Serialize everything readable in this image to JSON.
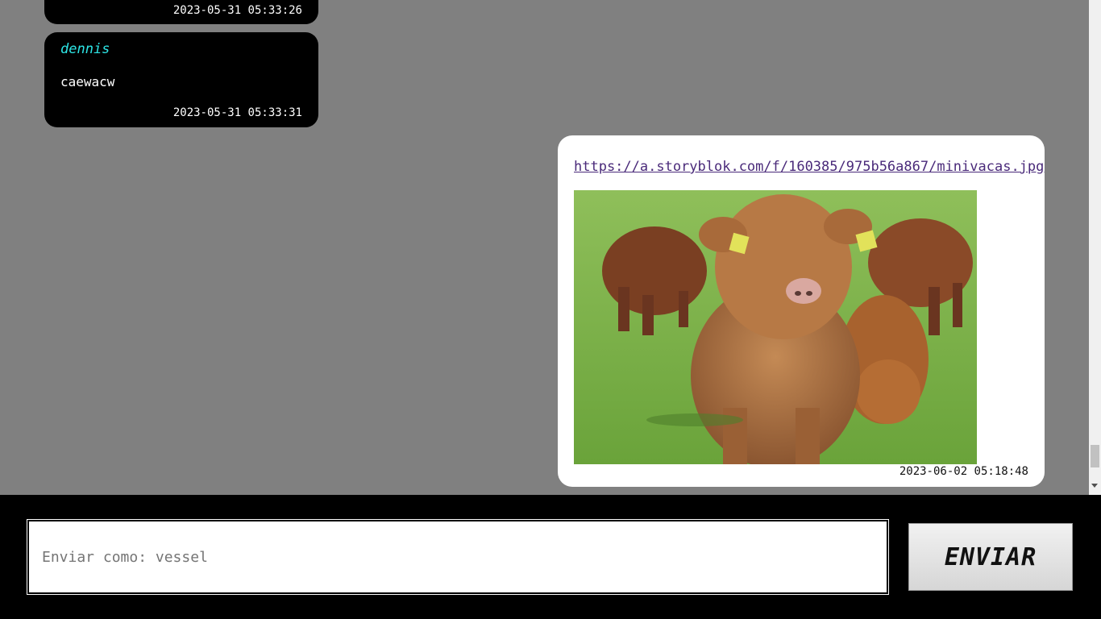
{
  "messages": [
    {
      "timestamp": "2023-05-31 05:33:26"
    },
    {
      "user": "dennis",
      "text": "caewacw",
      "timestamp": "2023-05-31 05:33:31"
    },
    {
      "link": "https://a.storyblok.com/f/160385/975b56a867/minivacas.jpg",
      "image": "photo of fluffy highland calves on grass",
      "timestamp": "2023-06-02 05:18:48"
    }
  ],
  "composer": {
    "placeholder": "Enviar como: vessel",
    "send_label": "ENVIAR"
  },
  "colors": {
    "background": "#808080",
    "username": "#2de6e6",
    "link": "#4a2a7a"
  }
}
